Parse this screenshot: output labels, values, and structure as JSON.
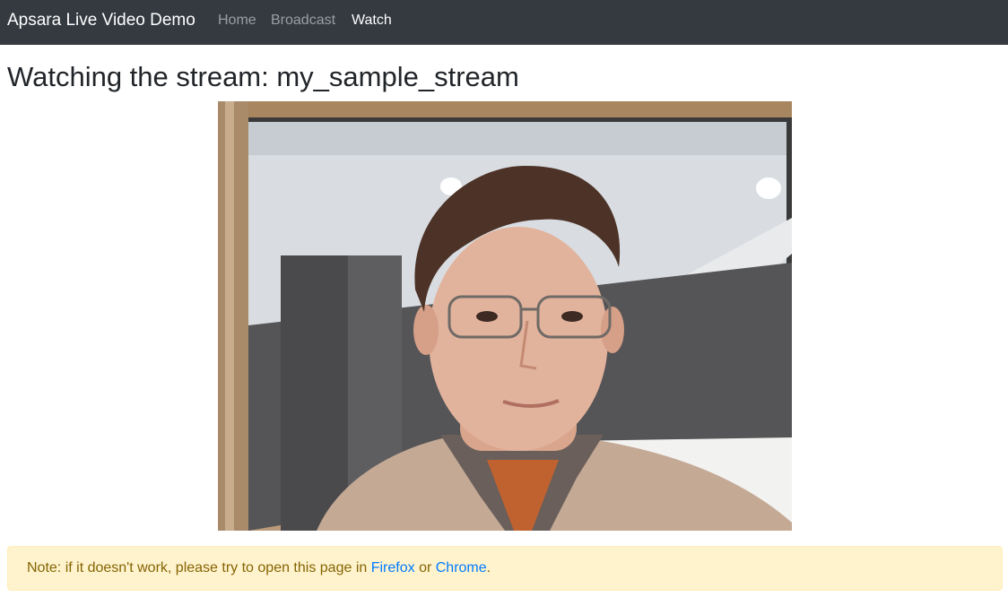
{
  "navbar": {
    "brand": "Apsara Live Video Demo",
    "links": [
      {
        "label": "Home",
        "active": false
      },
      {
        "label": "Broadcast",
        "active": false
      },
      {
        "label": "Watch",
        "active": true
      }
    ]
  },
  "main": {
    "title": "Watching the stream: my_sample_stream"
  },
  "alert": {
    "prefix": "Note: if it doesn't work, please try to open this page in ",
    "firefox_label": "Firefox",
    "middle": " or ",
    "chrome_label": "Chrome",
    "suffix": "."
  },
  "colors": {
    "navbar_bg": "#343a40",
    "alert_bg": "#fff3cd",
    "alert_text": "#856404",
    "link": "#007bff"
  }
}
